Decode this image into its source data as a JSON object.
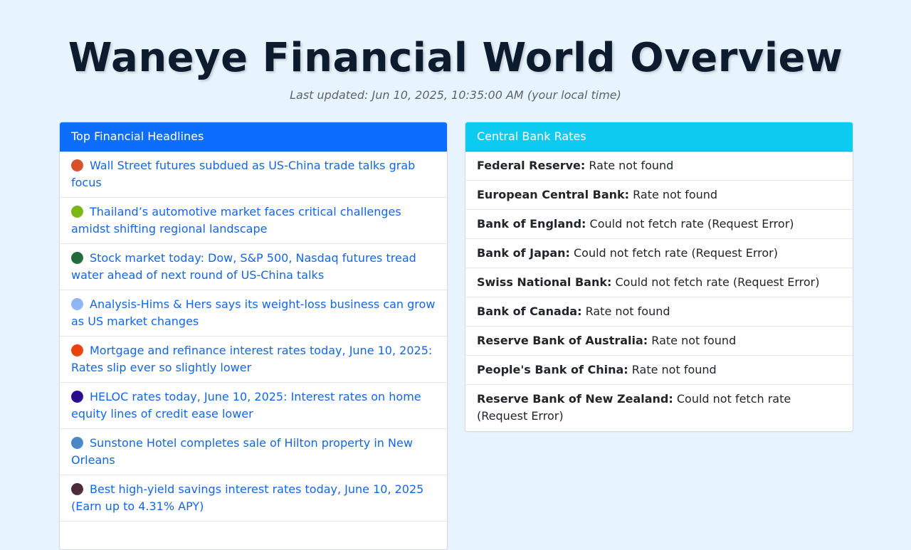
{
  "header": {
    "title": "Waneye Financial World Overview",
    "last_updated": "Last updated: Jun 10, 2025, 10:35:00 AM (your local time)"
  },
  "headlines_card": {
    "title": "Top Financial Headlines",
    "items": [
      {
        "text": "Wall Street futures subdued as US-China trade talks grab focus",
        "icon_color": "#d6502a"
      },
      {
        "text": "Thailand’s automotive market faces critical challenges amidst shifting regional landscape",
        "icon_color": "#7cb518"
      },
      {
        "text": "Stock market today: Dow, S&P 500, Nasdaq futures tread water ahead of next round of US-China talks",
        "icon_color": "#1e6b3c"
      },
      {
        "text": "Analysis-Hims & Hers says its weight-loss business can grow as US market changes",
        "icon_color": "#8fb5f5"
      },
      {
        "text": "Mortgage and refinance interest rates today, June 10, 2025: Rates slip ever so slightly lower",
        "icon_color": "#e8420f"
      },
      {
        "text": "HELOC rates today, June 10, 2025: Interest rates on home equity lines of credit ease lower",
        "icon_color": "#2a0b8c"
      },
      {
        "text": "Sunstone Hotel completes sale of Hilton property in New Orleans",
        "icon_color": "#4a86c8"
      },
      {
        "text": "Best high-yield savings interest rates today, June 10, 2025 (Earn up to 4.31% APY)",
        "icon_color": "#4d2a3a"
      }
    ]
  },
  "rates_card": {
    "title": "Central Bank Rates",
    "items": [
      {
        "bank": "Federal Reserve:",
        "status": "Rate not found"
      },
      {
        "bank": "European Central Bank:",
        "status": "Rate not found"
      },
      {
        "bank": "Bank of England:",
        "status": "Could not fetch rate (Request Error)"
      },
      {
        "bank": "Bank of Japan:",
        "status": "Could not fetch rate (Request Error)"
      },
      {
        "bank": "Swiss National Bank:",
        "status": "Could not fetch rate (Request Error)"
      },
      {
        "bank": "Bank of Canada:",
        "status": "Rate not found"
      },
      {
        "bank": "Reserve Bank of Australia:",
        "status": "Rate not found"
      },
      {
        "bank": "People's Bank of China:",
        "status": "Rate not found"
      },
      {
        "bank": "Reserve Bank of New Zealand:",
        "status": "Could not fetch rate (Request Error)"
      }
    ]
  },
  "colors": {
    "background": "#e8f4fd",
    "headlines_header": "#0d6efd",
    "rates_header": "#0dcaf0",
    "link": "#1466e6"
  }
}
